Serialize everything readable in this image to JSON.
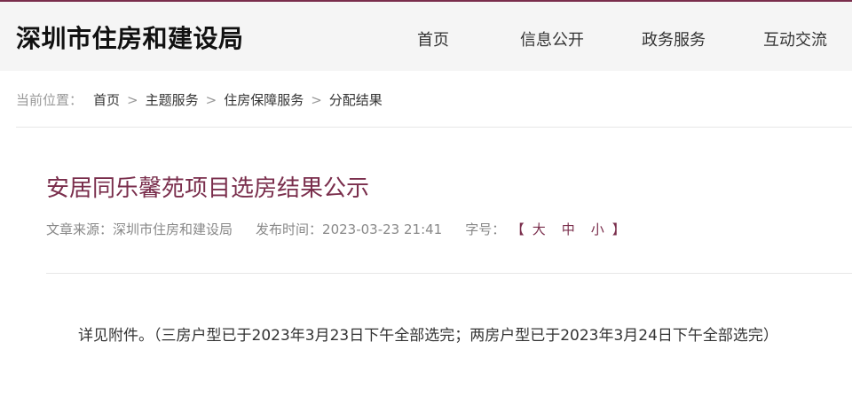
{
  "header": {
    "site_title": "深圳市住房和建设局",
    "nav": [
      "首页",
      "信息公开",
      "政务服务",
      "互动交流"
    ]
  },
  "breadcrumb": {
    "prefix": "当前位置：",
    "items": [
      "首页",
      "主题服务",
      "住房保障服务",
      "分配结果"
    ],
    "separator": ">"
  },
  "article": {
    "title": "安居同乐馨苑项目选房结果公示",
    "source_label": "文章来源：",
    "source": "深圳市住房和建设局",
    "time_label": "发布时间：",
    "time": "2023-03-23 21:41",
    "fontsize_label": "字号：",
    "bracket_open": "【",
    "fontsize_options": [
      "大",
      "中",
      "小"
    ],
    "bracket_close": "】",
    "body": "详见附件。（三房户型已于2023年3月23日下午全部选完；两房户型已于2023年3月24日下午全部选完）"
  },
  "colors": {
    "accent": "#7a2e4c",
    "header_bg": "#f5f5f5",
    "muted": "#888888"
  }
}
